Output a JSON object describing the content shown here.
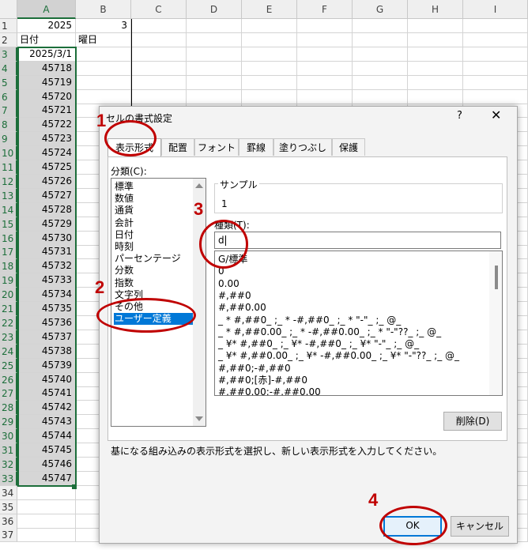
{
  "sheet": {
    "columns": [
      "A",
      "B",
      "C",
      "D",
      "E",
      "F",
      "G",
      "H",
      "I"
    ],
    "row_numbers": [
      "1",
      "2",
      "3",
      "4",
      "5",
      "6",
      "7",
      "8",
      "9",
      "10",
      "11",
      "12",
      "13",
      "14",
      "15",
      "16",
      "17",
      "18",
      "19",
      "20",
      "21",
      "22",
      "23",
      "24",
      "25",
      "26",
      "27",
      "28",
      "29",
      "30",
      "31",
      "32",
      "33",
      "34",
      "35",
      "36",
      "37"
    ],
    "cells": {
      "A1": "2025",
      "B1": "3",
      "A2": "日付",
      "B2": "曜日",
      "A3": "2025/3/1",
      "A_values": [
        "45718",
        "45719",
        "45720",
        "45721",
        "45722",
        "45723",
        "45724",
        "45725",
        "45726",
        "45727",
        "45728",
        "45729",
        "45730",
        "45731",
        "45732",
        "45733",
        "45734",
        "45735",
        "45736",
        "45737",
        "45738",
        "45739",
        "45740",
        "45741",
        "45742",
        "45743",
        "45744",
        "45745",
        "45746",
        "45747"
      ]
    }
  },
  "dialog": {
    "title": "セルの書式設定",
    "help": "?",
    "close": "✕",
    "tabs": [
      "表示形式",
      "配置",
      "フォント",
      "罫線",
      "塗りつぶし",
      "保護"
    ],
    "category_label": "分類(C):",
    "categories": [
      "標準",
      "数値",
      "通貨",
      "会計",
      "日付",
      "時刻",
      "パーセンテージ",
      "分数",
      "指数",
      "文字列",
      "その他",
      "ユーザー定義"
    ],
    "selected_category": "ユーザー定義",
    "sample_label": "サンプル",
    "sample_value": "1",
    "type_label": "種類(T):",
    "type_value": "d",
    "formats": [
      "G/標準",
      "0",
      "0.00",
      "#,##0",
      "#,##0.00",
      "_ * #,##0_ ;_ * -#,##0_ ;_ * \"-\"_ ;_ @_ ",
      "_ * #,##0.00_ ;_ * -#,##0.00_ ;_ * \"-\"??_ ;_ @_ ",
      "_ ¥* #,##0_ ;_ ¥* -#,##0_ ;_ ¥* \"-\"_ ;_ @_ ",
      "_ ¥* #,##0.00_ ;_ ¥* -#,##0.00_ ;_ ¥* \"-\"??_ ;_ @_ ",
      "#,##0;-#,##0",
      "#,##0;[赤]-#,##0",
      "#,##0.00;-#,##0.00"
    ],
    "delete_button": "削除(D)",
    "description": "基になる組み込みの表示形式を選択し、新しい表示形式を入力してください。",
    "ok": "OK",
    "cancel": "キャンセル"
  },
  "annotations": [
    "1",
    "2",
    "3",
    "4"
  ],
  "colors": {
    "annotation": "#c00000",
    "selection": "#1c6e3a",
    "list_highlight": "#0078d7"
  }
}
